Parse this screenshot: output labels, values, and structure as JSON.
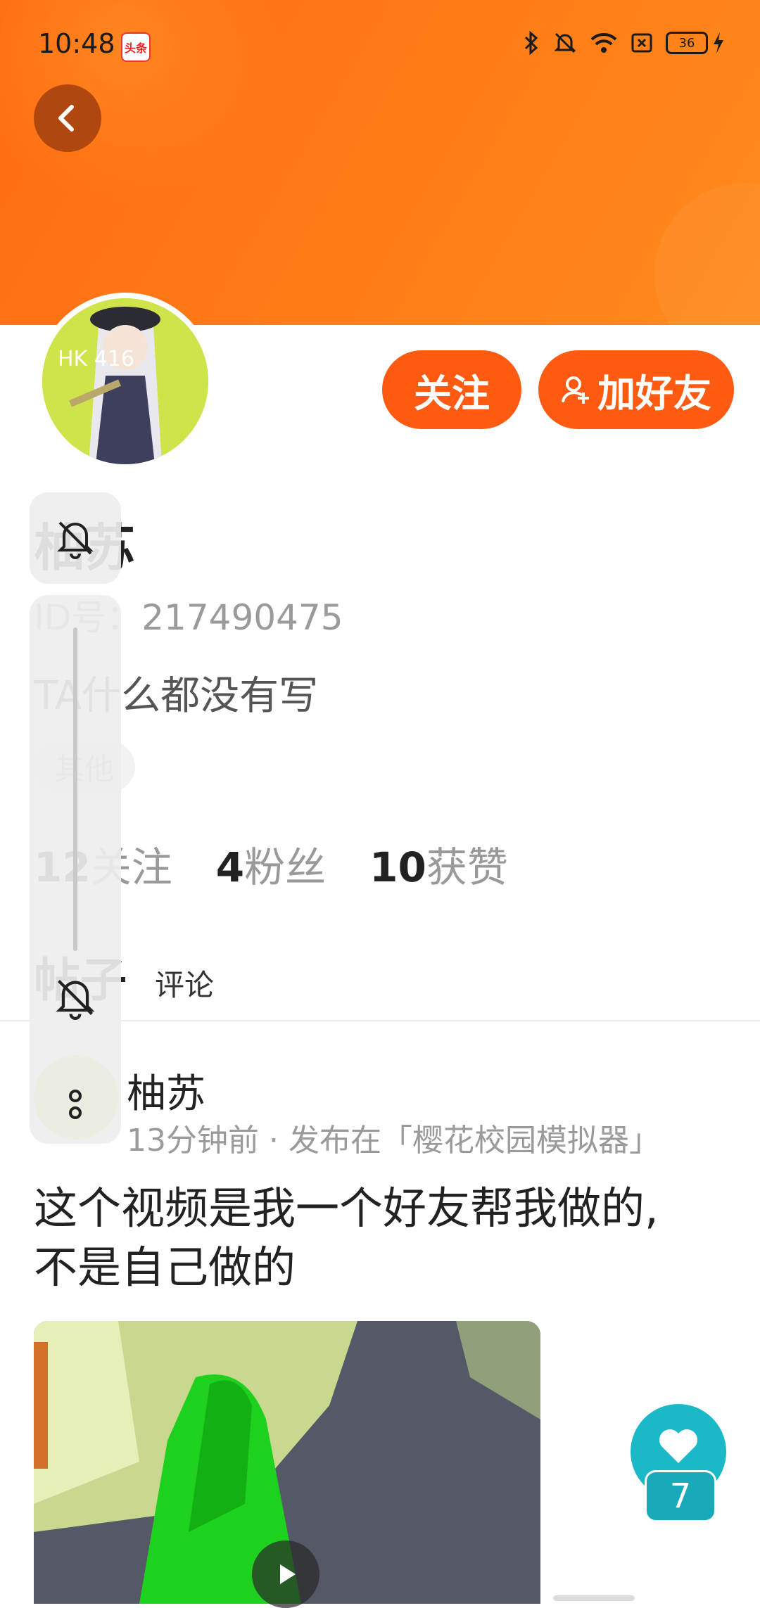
{
  "status_bar": {
    "time": "10:48",
    "app_badge": "头条",
    "battery": "36"
  },
  "profile": {
    "name": "柚苏",
    "id_label": "ID号：217490475",
    "bio": "TA什么都没有写",
    "tag": "其他",
    "follow_button": "关注",
    "add_friend_button": "加好友",
    "avatar_text": "HK 416"
  },
  "stats": [
    {
      "num": "12",
      "label": "关注"
    },
    {
      "num": "4",
      "label": "粉丝"
    },
    {
      "num": "10",
      "label": "获赞"
    }
  ],
  "tabs": {
    "posts": "帖子",
    "comments": "评论"
  },
  "post": {
    "author": "柚苏",
    "meta": "13分钟前 · 发布在「樱花校园模拟器」",
    "text_line1": "这个视频是我一个好友帮我做的,",
    "text_line2": "不是自己做的",
    "like_count": "7"
  },
  "colors": {
    "accent": "#ff5a12",
    "header": "#ff7a16",
    "like": "#1bb8c8"
  },
  "icons": [
    "back-arrow-icon",
    "bluetooth-icon",
    "bell-muted-icon",
    "wifi-icon",
    "sim-icon",
    "battery-icon",
    "user-plus-icon",
    "play-icon",
    "heart-icon",
    "more-icon"
  ]
}
